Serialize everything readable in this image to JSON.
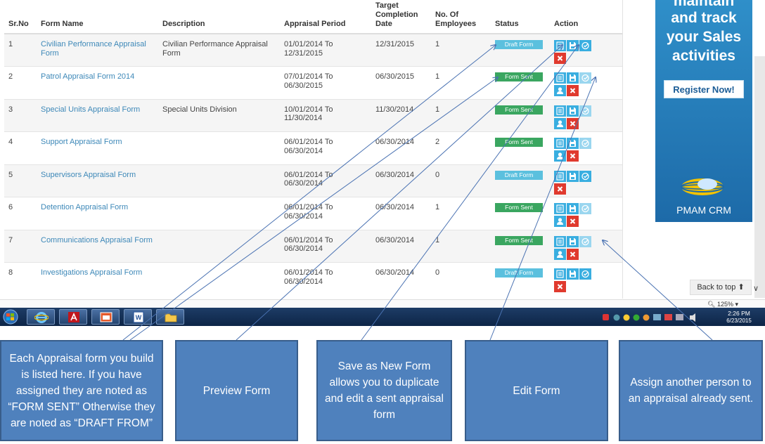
{
  "table": {
    "headers": {
      "srno": "Sr.No",
      "form_name": "Form Name",
      "description": "Description",
      "appraisal_period": "Appraisal Period",
      "target_line1": "Target",
      "target_line2": "Completion",
      "target_line3": "Date",
      "employees_line1": "No. Of",
      "employees_line2": "Employees",
      "status": "Status",
      "action": "Action"
    },
    "rows": [
      {
        "sr": "1",
        "name": "Civilian Performance Appraisal Form",
        "description": "Civilian Performance Appraisal Form",
        "period_from": "01/01/2014 To",
        "period_to": "12/31/2015",
        "target": "12/31/2015",
        "employees": "1",
        "status": "Draft Form",
        "status_kind": "draft"
      },
      {
        "sr": "2",
        "name": "Patrol Appraisal Form 2014",
        "description": "",
        "period_from": "07/01/2014 To",
        "period_to": "06/30/2015",
        "target": "06/30/2015",
        "employees": "1",
        "status": "Form Sent",
        "status_kind": "sent"
      },
      {
        "sr": "3",
        "name": "Special Units Appraisal Form",
        "description": "Special Units Division",
        "period_from": "10/01/2014 To",
        "period_to": "11/30/2014",
        "target": "11/30/2014",
        "employees": "1",
        "status": "Form Sent",
        "status_kind": "sent"
      },
      {
        "sr": "4",
        "name": "Support Appraisal Form",
        "description": "",
        "period_from": "06/01/2014 To",
        "period_to": "06/30/2014",
        "target": "06/30/2014",
        "employees": "2",
        "status": "Form Sent",
        "status_kind": "sent"
      },
      {
        "sr": "5",
        "name": "Supervisors Appraisal Form",
        "description": "",
        "period_from": "06/01/2014 To",
        "period_to": "06/30/2014",
        "target": "06/30/2014",
        "employees": "0",
        "status": "Draft Form",
        "status_kind": "draft"
      },
      {
        "sr": "6",
        "name": "Detention Appraisal Form",
        "description": "",
        "period_from": "06/01/2014 To",
        "period_to": "06/30/2014",
        "target": "06/30/2014",
        "employees": "1",
        "status": "Form Sent",
        "status_kind": "sent"
      },
      {
        "sr": "7",
        "name": "Communications Appraisal Form",
        "description": "",
        "period_from": "06/01/2014 To",
        "period_to": "06/30/2014",
        "target": "06/30/2014",
        "employees": "1",
        "status": "Form Sent",
        "status_kind": "sent"
      },
      {
        "sr": "8",
        "name": "Investigations Appraisal Form",
        "description": "",
        "period_from": "06/01/2014 To",
        "period_to": "06/30/2014",
        "target": "06/30/2014",
        "employees": "0",
        "status": "Draft Form",
        "status_kind": "draft"
      }
    ]
  },
  "ad": {
    "line1": "maintain",
    "line2": "and track",
    "line3": "your Sales",
    "line4": "activities",
    "button": "Register Now!",
    "brand": "PMAM CRM"
  },
  "browser": {
    "back_to_top": "Back to top",
    "zoom": "125%"
  },
  "taskbar": {
    "time": "2:26 PM",
    "date": "6/23/2015"
  },
  "callouts": {
    "list": "Each Appraisal form you build is listed here. If you have assigned they are noted as “FORM SENT” Otherwise they are noted as “DRAFT FROM”",
    "preview": "Preview Form",
    "save_new": "Save as New Form allows you to duplicate and edit a sent appraisal form",
    "edit": "Edit Form",
    "assign": "Assign another person to an appraisal already sent."
  },
  "colors": {
    "draft_badge": "#5bc0de",
    "sent_badge": "#3aa660",
    "link": "#3d88b8",
    "action_blue": "#39aee0",
    "action_red": "#e03a2e",
    "callout_fill": "#4f81bd"
  },
  "icons": {
    "preview": "document-list-icon",
    "save": "floppy-save-icon",
    "edit": "edit-check-icon",
    "assign": "user-icon",
    "delete": "close-icon"
  }
}
